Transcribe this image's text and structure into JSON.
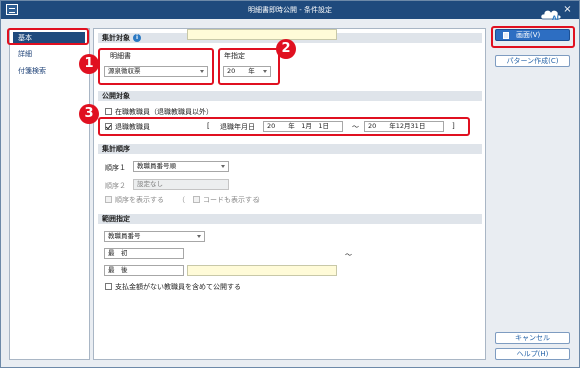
{
  "window": {
    "title": "明細書即時公開 - 条件設定"
  },
  "sidebar": {
    "items": [
      {
        "label": "基本"
      },
      {
        "label": "詳細"
      },
      {
        "label": "付箋検索"
      }
    ]
  },
  "aggregation": {
    "header": "集計対象",
    "document_label": "明細書",
    "document_value": "源泉徴収票",
    "year_label": "年指定",
    "year_value": "20　　年"
  },
  "publication": {
    "header": "公開対象",
    "enrolled_label": "在職教職員（退職教職員以外）",
    "enrolled_checked": false,
    "retired_label": "退職教職員",
    "retired_checked": true,
    "bracket_open": "[",
    "retire_date_label": "退職年月日",
    "date_from": "20　　年　1月　1日",
    "tilde": "～",
    "date_to": "20　　年12月31日",
    "bracket_close": "]"
  },
  "order": {
    "header": "集計順序",
    "order1_label": "順序１",
    "order1_value": "教職員番号順",
    "order2_label": "順序２",
    "order2_value": "設定なし",
    "show_order_label": "順序を表示する",
    "paren_open": "（",
    "show_code_label": "コードも表示する",
    "paren_close": "）"
  },
  "range": {
    "header": "範囲指定",
    "field_value": "教職員番号",
    "first_label": "最　初",
    "last_label": "最　後",
    "tilde": "～",
    "include_zero_label": "支払金額がない教職員を含めて公開する"
  },
  "buttons": {
    "print": "画面(V)",
    "pattern": "パターン作成(C)",
    "cancel": "キャンセル",
    "help": "ヘルプ(H)"
  },
  "callouts": [
    "1",
    "2",
    "3"
  ],
  "colors": {
    "titlebar": "#1f4a7d",
    "highlight": "#e01020",
    "primary": "#2d6ec2"
  }
}
